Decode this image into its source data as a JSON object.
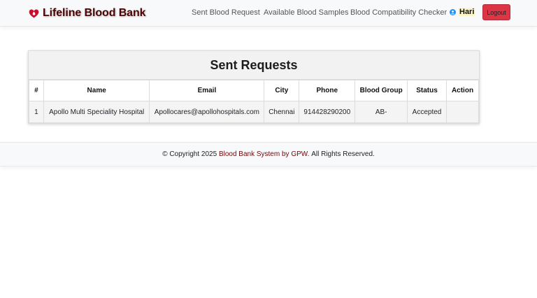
{
  "brand": {
    "name": "Lifeline Blood Bank",
    "color": "#4a0404"
  },
  "nav": {
    "links": [
      "Sent Blood Request",
      "Available Blood Samples",
      "Blood Compatibility Checker"
    ],
    "user_name": "Hari",
    "logout_label": "Logout",
    "logout_color": "#dc3545"
  },
  "requests": {
    "title": "Sent Requests",
    "columns": [
      "#",
      "Name",
      "Email",
      "City",
      "Phone",
      "Blood Group",
      "Status",
      "Action"
    ],
    "rows": [
      [
        "1",
        "Apollo Multi Speciality Hospital",
        "Apollocares@apollohospitals.com",
        "Chennai",
        "914428290200",
        "AB-",
        "Accepted",
        ""
      ]
    ]
  },
  "footer": {
    "prefix": "© Copyright 2025",
    "system": "Blood Bank System by GPW.",
    "suffix": "All Rights Reserved."
  }
}
